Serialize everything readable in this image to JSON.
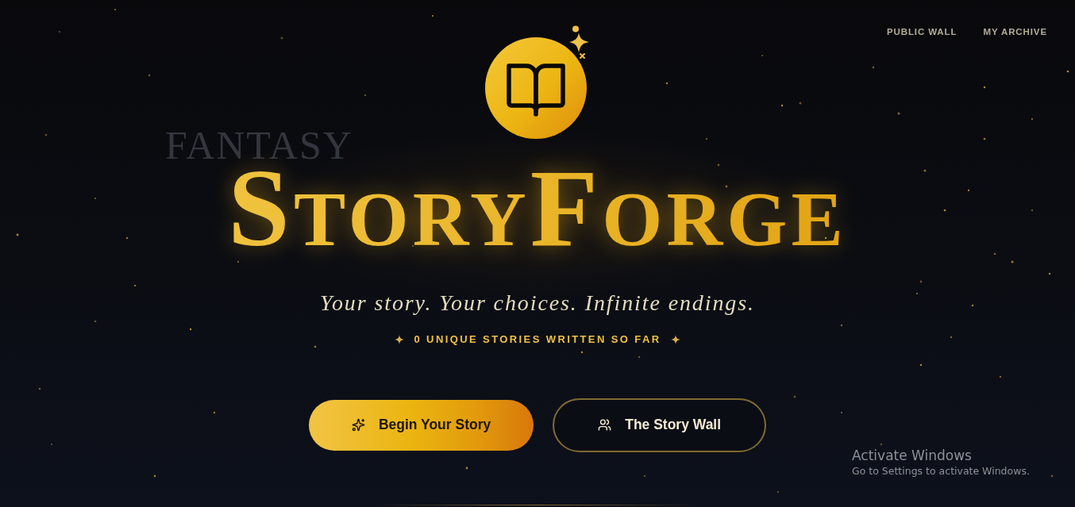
{
  "nav": {
    "links": [
      {
        "label": "PUBLIC WALL"
      },
      {
        "label": "MY ARCHIVE"
      }
    ]
  },
  "background_words": [
    {
      "text": "FANTASY"
    }
  ],
  "hero": {
    "title": "StoryForge",
    "tagline": "Your story. Your choices. Infinite endings.",
    "counter": "0 UNIQUE STORIES WRITTEN SO FAR"
  },
  "actions": [
    {
      "label": "Begin Your Story",
      "kind": "primary"
    },
    {
      "label": "The Story Wall",
      "kind": "secondary"
    }
  ],
  "os_notice": {
    "title": "Activate Windows",
    "message": "Go to Settings to activate Windows."
  }
}
